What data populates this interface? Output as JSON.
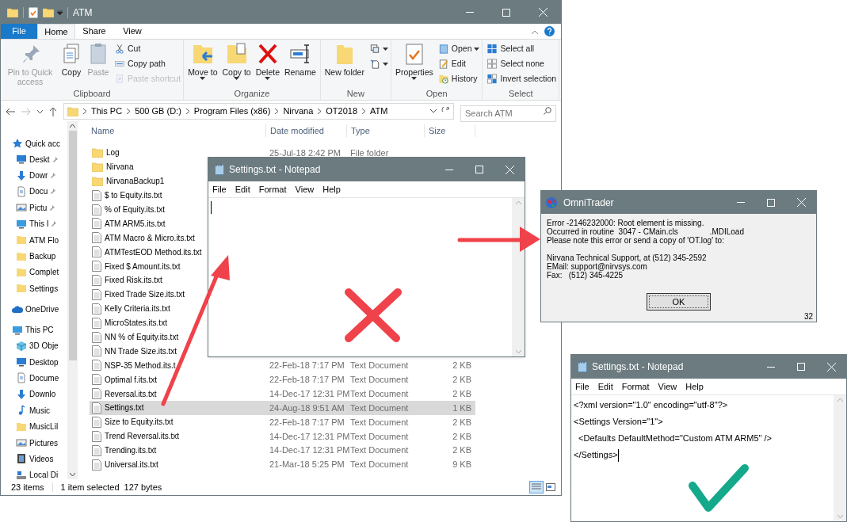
{
  "explorer": {
    "title": "ATM",
    "tabs": [
      {
        "label": "File",
        "selected": false,
        "kind": "file"
      },
      {
        "label": "Home",
        "selected": true,
        "kind": "tab"
      },
      {
        "label": "Share",
        "selected": false,
        "kind": "tab"
      },
      {
        "label": "View",
        "selected": false,
        "kind": "tab"
      }
    ],
    "ribbon_groups": [
      {
        "label": "Clipboard",
        "large": [
          {
            "label": "Pin to Quick access",
            "kind": "pin",
            "disabled": true,
            "dropdown": false
          },
          {
            "label": "Copy",
            "kind": "copy",
            "disabled": false,
            "dropdown": false
          },
          {
            "label": "Paste",
            "kind": "paste",
            "disabled": true,
            "dropdown": false
          }
        ],
        "small": [
          {
            "label": "Cut",
            "kind": "cut",
            "disabled": false,
            "dropdown": false
          },
          {
            "label": "Copy path",
            "kind": "path",
            "disabled": false,
            "dropdown": false
          },
          {
            "label": "Paste shortcut",
            "kind": "shortcut",
            "disabled": true,
            "dropdown": false
          }
        ]
      },
      {
        "label": "Organize",
        "large": [
          {
            "label": "Move to",
            "kind": "move",
            "disabled": false,
            "dropdown": true
          },
          {
            "label": "Copy to",
            "kind": "copyto",
            "disabled": false,
            "dropdown": true
          },
          {
            "label": "Delete",
            "kind": "delete",
            "disabled": false,
            "dropdown": true
          },
          {
            "label": "Rename",
            "kind": "rename",
            "disabled": false,
            "dropdown": false
          }
        ]
      },
      {
        "label": "New",
        "large": [
          {
            "label": "New folder",
            "kind": "folder",
            "disabled": false,
            "dropdown": false
          }
        ],
        "small": [
          {
            "kind": "newitem",
            "disabled": false,
            "dropdown": true
          },
          {
            "kind": "easy",
            "disabled": false,
            "dropdown": true
          }
        ]
      },
      {
        "label": "Open",
        "large": [
          {
            "label": "Properties",
            "kind": "properties",
            "disabled": false,
            "dropdown": true
          }
        ],
        "small": [
          {
            "label": "Open",
            "kind": "open",
            "disabled": false,
            "dropdown": true
          },
          {
            "label": "Edit",
            "kind": "edit",
            "disabled": false,
            "dropdown": false
          },
          {
            "label": "History",
            "kind": "history",
            "disabled": false,
            "dropdown": false
          }
        ]
      },
      {
        "label": "Select",
        "small": [
          {
            "label": "Select all",
            "kind": "selall",
            "disabled": false,
            "dropdown": false
          },
          {
            "label": "Select none",
            "kind": "selnone",
            "disabled": false,
            "dropdown": false
          },
          {
            "label": "Invert selection",
            "kind": "selinv",
            "disabled": false,
            "dropdown": false
          }
        ]
      }
    ],
    "breadcrumbs": [
      "This PC",
      "500 GB (D:)",
      "Program Files (x86)",
      "Nirvana",
      "OT2018",
      "ATM"
    ],
    "search": {
      "placeholder": "Search ATM"
    },
    "sidebar": [
      {
        "label": "Quick acc",
        "kind": "star",
        "children": [
          {
            "label": "Deskt",
            "kind": "desktop",
            "pinned": true
          },
          {
            "label": "Dowr",
            "kind": "download",
            "pinned": true
          },
          {
            "label": "Docu",
            "kind": "document",
            "pinned": true
          },
          {
            "label": "Pictu",
            "kind": "pictures",
            "pinned": true
          },
          {
            "label": "This I",
            "kind": "pc",
            "pinned": true
          },
          {
            "label": "ATM Flo",
            "kind": "folder",
            "pinned": false
          },
          {
            "label": "Backup",
            "kind": "folder",
            "pinned": false
          },
          {
            "label": "Complet",
            "kind": "folder",
            "pinned": false
          },
          {
            "label": "Settings",
            "kind": "folder",
            "pinned": false
          }
        ]
      },
      {
        "label": "OneDrive",
        "kind": "cloud"
      },
      {
        "label": "This PC",
        "kind": "pc",
        "children": [
          {
            "label": "3D Obje",
            "kind": "cube",
            "pinned": false
          },
          {
            "label": "Desktop",
            "kind": "desktop",
            "pinned": false
          },
          {
            "label": "Docume",
            "kind": "document",
            "pinned": false
          },
          {
            "label": "Downlo",
            "kind": "download",
            "pinned": false
          },
          {
            "label": "Music",
            "kind": "music",
            "pinned": false
          },
          {
            "label": "MusicLil",
            "kind": "folder",
            "pinned": false
          },
          {
            "label": "Pictures",
            "kind": "pictures",
            "pinned": false
          },
          {
            "label": "Videos",
            "kind": "video",
            "pinned": false
          },
          {
            "label": "Local Di",
            "kind": "drive",
            "pinned": false
          }
        ]
      }
    ],
    "columns": [
      "Name",
      "Date modified",
      "Type",
      "Size"
    ],
    "rows": [
      {
        "name": "Log",
        "kind": "folder",
        "date": "25-Jul-18 2:42 PM",
        "type": "File folder",
        "selected": false
      },
      {
        "name": "Nirvana",
        "kind": "folder",
        "selected": false
      },
      {
        "name": "NirvanaBackup1",
        "kind": "folder",
        "selected": false
      },
      {
        "name": "$ to Equity.its.txt",
        "kind": "file",
        "selected": false
      },
      {
        "name": "% of Equity.its.txt",
        "kind": "file",
        "selected": false
      },
      {
        "name": "ATM ARM5.its.txt",
        "kind": "file",
        "selected": false
      },
      {
        "name": "ATM Macro & Micro.its.txt",
        "kind": "file",
        "selected": false
      },
      {
        "name": "ATMTestEOD Method.its.txt",
        "kind": "file",
        "selected": false
      },
      {
        "name": "Fixed $ Amount.its.txt",
        "kind": "file",
        "selected": false
      },
      {
        "name": "Fixed Risk.its.txt",
        "kind": "file",
        "selected": false
      },
      {
        "name": "Fixed Trade Size.its.txt",
        "kind": "file",
        "selected": false
      },
      {
        "name": "Kelly Criteria.its.txt",
        "kind": "file",
        "selected": false
      },
      {
        "name": "MicroStates.its.txt",
        "kind": "file",
        "selected": false
      },
      {
        "name": "NN % of Equity.its.txt",
        "kind": "file",
        "selected": false
      },
      {
        "name": "NN Trade Size.its.txt",
        "kind": "file",
        "selected": false
      },
      {
        "name": "NSP-35 Method.its.t",
        "kind": "file",
        "date": "22-Feb-18 7:17 PM",
        "type": "Text Document",
        "size": "2 KB",
        "selected": false
      },
      {
        "name": "Optimal f.its.txt",
        "kind": "file",
        "date": "22-Feb-18 7:17 PM",
        "type": "Text Document",
        "size": "2 KB",
        "selected": false
      },
      {
        "name": "Reversal.its.txt",
        "kind": "file",
        "date": "14-Dec-17 12:31 PM",
        "type": "Text Document",
        "size": "2 KB",
        "selected": false
      },
      {
        "name": "Settings.txt",
        "kind": "file",
        "date": "24-Aug-18 9:51 AM",
        "type": "Text Document",
        "size": "1 KB",
        "selected": true
      },
      {
        "name": "Size to Equity.its.txt",
        "kind": "file",
        "date": "22-Feb-18 7:17 PM",
        "type": "Text Document",
        "size": "2 KB",
        "selected": false
      },
      {
        "name": "Trend Reversal.its.txt",
        "kind": "file",
        "date": "14-Dec-17 12:31 PM",
        "type": "Text Document",
        "size": "2 KB",
        "selected": false
      },
      {
        "name": "Trending.its.txt",
        "kind": "file",
        "date": "14-Dec-17 12:31 PM",
        "type": "Text Document",
        "size": "2 KB",
        "selected": false
      },
      {
        "name": "Universal.its.txt",
        "kind": "file",
        "date": "21-Mar-18 5:25 PM",
        "type": "Text Document",
        "size": "9 KB",
        "selected": false
      }
    ],
    "status_bar": [
      "23 items",
      "1 item selected",
      "127 bytes"
    ]
  },
  "notepad_empty": {
    "title": "Settings.txt - Notepad",
    "menu": [
      "File",
      "Edit",
      "Format",
      "View",
      "Help"
    ]
  },
  "error_dialog": {
    "title": "OmniTrader",
    "paragraphs": [
      [
        [
          "Error -2146232000: Root element is missing."
        ],
        [
          "Occurred in routine  3047 - CMain.cls",
          ".MDILoad"
        ],
        [
          "Please note this error or send a copy of 'OT.log' to:"
        ]
      ],
      [
        [
          "Nirvana Technical Support, at (512) 345-2592"
        ],
        [
          "EMail: support@nirvsys.com"
        ],
        [
          "Fax:   (512) 345-4225"
        ]
      ]
    ],
    "button": "OK",
    "corner": "32"
  },
  "notepad_fixed": {
    "title": "Settings.txt - Notepad",
    "menu": [
      "File",
      "Edit",
      "Format",
      "View",
      "Help"
    ],
    "lines": [
      "<?xml version=\"1.0\" encoding=\"utf-8\"?>",
      "<Settings Version=\"1\">",
      "  <Defaults DefaultMethod=\"Custom ATM ARM5\" />",
      "</Settings>"
    ]
  }
}
